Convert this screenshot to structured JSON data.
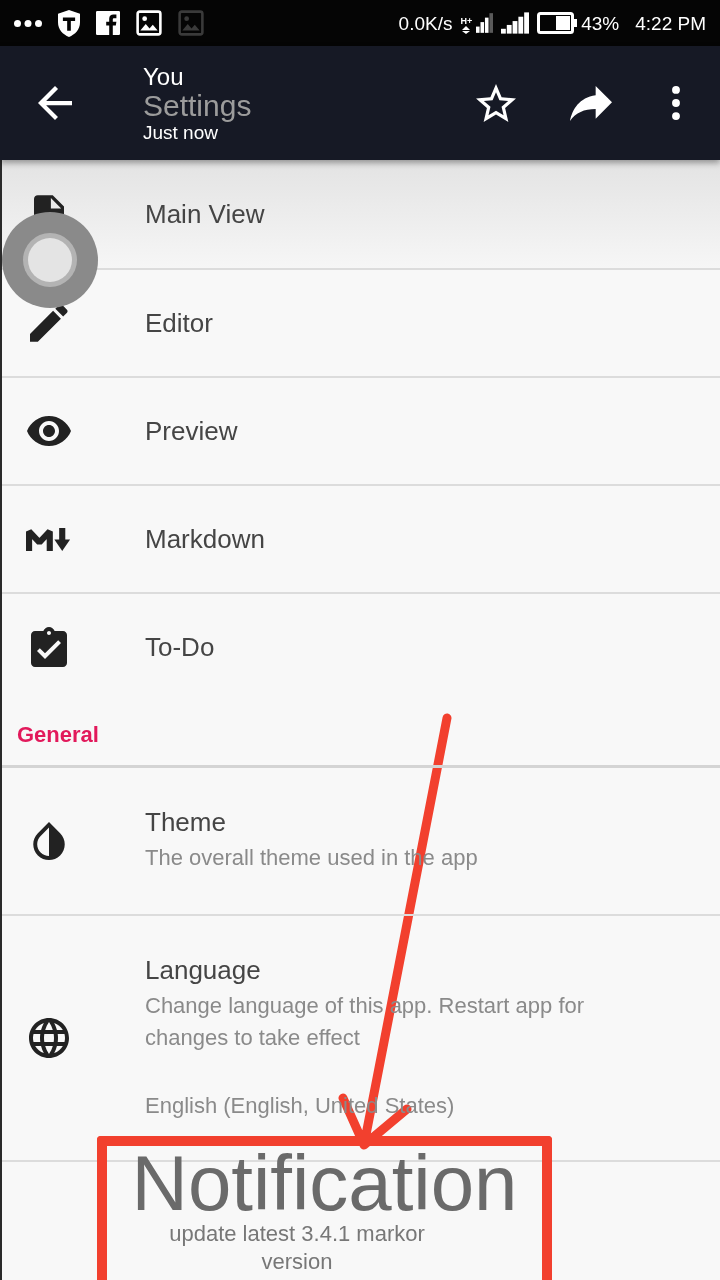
{
  "status_bar": {
    "network_speed": "0.0K/s",
    "network_type": "H+",
    "battery": "43%",
    "time": "4:22 PM"
  },
  "toolbar": {
    "overlay_author": "You",
    "title": "Settings",
    "overlay_time": "Just now"
  },
  "sections": [
    {
      "items": [
        {
          "title": "Main View",
          "pressed": true
        },
        {
          "title": "Editor",
          "pressed": false
        },
        {
          "title": "Preview",
          "pressed": false
        },
        {
          "title": "Markdown",
          "pressed": false
        },
        {
          "title": "To-Do",
          "pressed": false
        }
      ]
    },
    {
      "header": "General",
      "items": [
        {
          "title": "Theme",
          "summary": "The overall theme used in the app",
          "pressed": false
        },
        {
          "title": "Language",
          "summary": "Change language of this app. Restart app for changes to take effect",
          "value": "English (English, United States)",
          "pressed": false
        }
      ]
    }
  ],
  "annotation": {
    "title": "Notification",
    "caption": "update latest 3.4.1 markor version"
  }
}
